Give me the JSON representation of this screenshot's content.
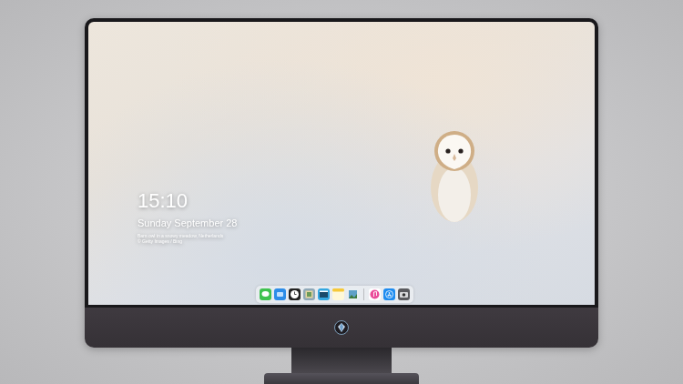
{
  "lock_screen": {
    "time": "15:10",
    "date": "Sunday September 28",
    "caption": [
      "Barn owl in a snowy meadow, Netherlands",
      "© Getty Images / Bing"
    ]
  }
}
